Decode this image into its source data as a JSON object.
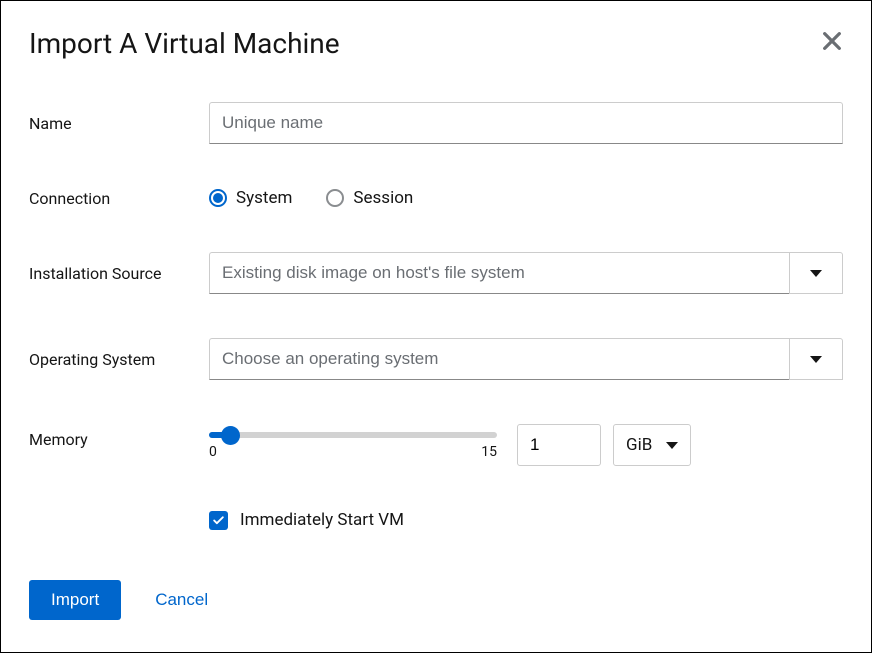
{
  "dialog": {
    "title": "Import A Virtual Machine"
  },
  "labels": {
    "name": "Name",
    "connection": "Connection",
    "installation_source": "Installation Source",
    "operating_system": "Operating System",
    "memory": "Memory"
  },
  "name_field": {
    "placeholder": "Unique name",
    "value": ""
  },
  "connection": {
    "options": {
      "system": "System",
      "session": "Session"
    },
    "selected": "system"
  },
  "installation_source": {
    "placeholder": "Existing disk image on host's file system",
    "value": ""
  },
  "operating_system": {
    "placeholder": "Choose an operating system",
    "value": ""
  },
  "memory": {
    "min": "0",
    "max": "15",
    "value": "1",
    "unit": "GiB"
  },
  "immediately_start": {
    "label": "Immediately Start VM",
    "checked": true
  },
  "buttons": {
    "import": "Import",
    "cancel": "Cancel"
  }
}
